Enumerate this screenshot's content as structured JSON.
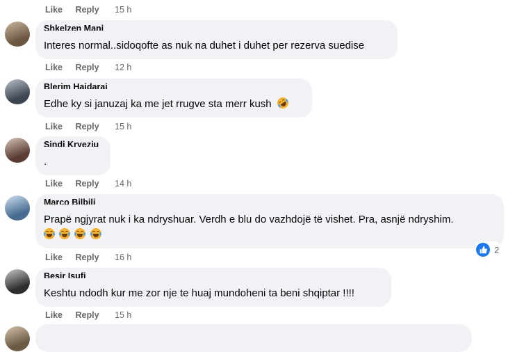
{
  "labels": {
    "like": "Like",
    "reply": "Reply"
  },
  "comments": [
    {
      "time": "15 h"
    },
    {
      "author": "Shkelzen Mani",
      "text": "Interes normal..sidoqofte as nuk na duhet i duhet per rezerva suedise",
      "time": "12 h",
      "avatar_color": "#8a7560"
    },
    {
      "author": "Blerim Hajdaraj",
      "text": "Edhe ky si januzaj ka me jet rrugve sta merr kush",
      "time": "15 h",
      "avatar_color": "#5e6a75",
      "emoji": "rolling-on-floor-laughing"
    },
    {
      "author": "Sindi Kryeziu",
      "text": ".",
      "time": "14 h",
      "avatar_color": "#7d5f55"
    },
    {
      "author": "Marco Bilbili",
      "text": "Prapë ngjyrat nuk i ka ndryshuar. Verdh e blu do vazhdojë të vishet. Pra, asnjë ndryshim.",
      "time": "16 h",
      "avatar_color": "#5f87b0",
      "emoji_row": [
        "face-with-tears-of-joy",
        "face-with-tears-of-joy",
        "face-with-tears-of-joy",
        "face-with-tears-of-joy"
      ],
      "reaction": {
        "type": "like",
        "count": "2",
        "color": "#1877f2"
      }
    },
    {
      "author": "Besir Isufi",
      "text": "Keshtu ndodh kur me zor nje te huaj mundoheni ta beni shqiptar !!!!",
      "time": "15 h",
      "avatar_color": "#4a4a4a"
    },
    {
      "author": "",
      "text": ""
    }
  ]
}
